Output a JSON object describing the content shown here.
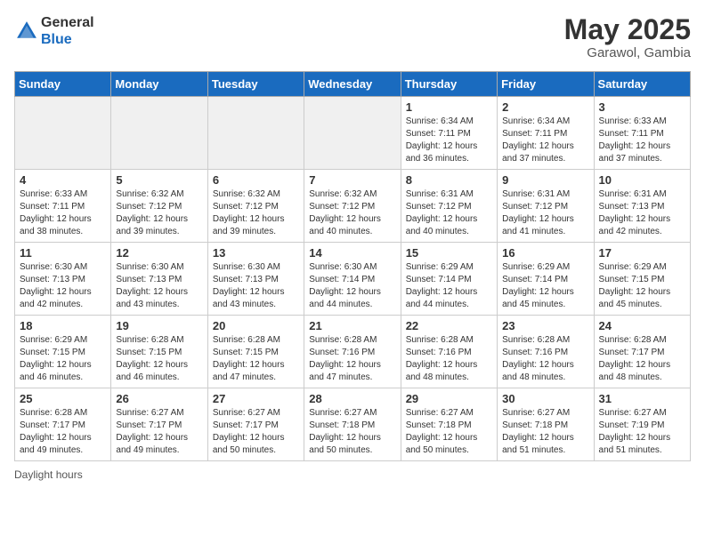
{
  "header": {
    "logo_general": "General",
    "logo_blue": "Blue",
    "month_year": "May 2025",
    "location": "Garawol, Gambia"
  },
  "days_of_week": [
    "Sunday",
    "Monday",
    "Tuesday",
    "Wednesday",
    "Thursday",
    "Friday",
    "Saturday"
  ],
  "weeks": [
    [
      {
        "day": "",
        "info": "",
        "shaded": true
      },
      {
        "day": "",
        "info": "",
        "shaded": true
      },
      {
        "day": "",
        "info": "",
        "shaded": true
      },
      {
        "day": "",
        "info": "",
        "shaded": true
      },
      {
        "day": "1",
        "info": "Sunrise: 6:34 AM\nSunset: 7:11 PM\nDaylight: 12 hours and 36 minutes."
      },
      {
        "day": "2",
        "info": "Sunrise: 6:34 AM\nSunset: 7:11 PM\nDaylight: 12 hours and 37 minutes."
      },
      {
        "day": "3",
        "info": "Sunrise: 6:33 AM\nSunset: 7:11 PM\nDaylight: 12 hours and 37 minutes."
      }
    ],
    [
      {
        "day": "4",
        "info": "Sunrise: 6:33 AM\nSunset: 7:11 PM\nDaylight: 12 hours and 38 minutes."
      },
      {
        "day": "5",
        "info": "Sunrise: 6:32 AM\nSunset: 7:12 PM\nDaylight: 12 hours and 39 minutes."
      },
      {
        "day": "6",
        "info": "Sunrise: 6:32 AM\nSunset: 7:12 PM\nDaylight: 12 hours and 39 minutes."
      },
      {
        "day": "7",
        "info": "Sunrise: 6:32 AM\nSunset: 7:12 PM\nDaylight: 12 hours and 40 minutes."
      },
      {
        "day": "8",
        "info": "Sunrise: 6:31 AM\nSunset: 7:12 PM\nDaylight: 12 hours and 40 minutes."
      },
      {
        "day": "9",
        "info": "Sunrise: 6:31 AM\nSunset: 7:12 PM\nDaylight: 12 hours and 41 minutes."
      },
      {
        "day": "10",
        "info": "Sunrise: 6:31 AM\nSunset: 7:13 PM\nDaylight: 12 hours and 42 minutes."
      }
    ],
    [
      {
        "day": "11",
        "info": "Sunrise: 6:30 AM\nSunset: 7:13 PM\nDaylight: 12 hours and 42 minutes."
      },
      {
        "day": "12",
        "info": "Sunrise: 6:30 AM\nSunset: 7:13 PM\nDaylight: 12 hours and 43 minutes."
      },
      {
        "day": "13",
        "info": "Sunrise: 6:30 AM\nSunset: 7:13 PM\nDaylight: 12 hours and 43 minutes."
      },
      {
        "day": "14",
        "info": "Sunrise: 6:30 AM\nSunset: 7:14 PM\nDaylight: 12 hours and 44 minutes."
      },
      {
        "day": "15",
        "info": "Sunrise: 6:29 AM\nSunset: 7:14 PM\nDaylight: 12 hours and 44 minutes."
      },
      {
        "day": "16",
        "info": "Sunrise: 6:29 AM\nSunset: 7:14 PM\nDaylight: 12 hours and 45 minutes."
      },
      {
        "day": "17",
        "info": "Sunrise: 6:29 AM\nSunset: 7:15 PM\nDaylight: 12 hours and 45 minutes."
      }
    ],
    [
      {
        "day": "18",
        "info": "Sunrise: 6:29 AM\nSunset: 7:15 PM\nDaylight: 12 hours and 46 minutes."
      },
      {
        "day": "19",
        "info": "Sunrise: 6:28 AM\nSunset: 7:15 PM\nDaylight: 12 hours and 46 minutes."
      },
      {
        "day": "20",
        "info": "Sunrise: 6:28 AM\nSunset: 7:15 PM\nDaylight: 12 hours and 47 minutes."
      },
      {
        "day": "21",
        "info": "Sunrise: 6:28 AM\nSunset: 7:16 PM\nDaylight: 12 hours and 47 minutes."
      },
      {
        "day": "22",
        "info": "Sunrise: 6:28 AM\nSunset: 7:16 PM\nDaylight: 12 hours and 48 minutes."
      },
      {
        "day": "23",
        "info": "Sunrise: 6:28 AM\nSunset: 7:16 PM\nDaylight: 12 hours and 48 minutes."
      },
      {
        "day": "24",
        "info": "Sunrise: 6:28 AM\nSunset: 7:17 PM\nDaylight: 12 hours and 48 minutes."
      }
    ],
    [
      {
        "day": "25",
        "info": "Sunrise: 6:28 AM\nSunset: 7:17 PM\nDaylight: 12 hours and 49 minutes."
      },
      {
        "day": "26",
        "info": "Sunrise: 6:27 AM\nSunset: 7:17 PM\nDaylight: 12 hours and 49 minutes."
      },
      {
        "day": "27",
        "info": "Sunrise: 6:27 AM\nSunset: 7:17 PM\nDaylight: 12 hours and 50 minutes."
      },
      {
        "day": "28",
        "info": "Sunrise: 6:27 AM\nSunset: 7:18 PM\nDaylight: 12 hours and 50 minutes."
      },
      {
        "day": "29",
        "info": "Sunrise: 6:27 AM\nSunset: 7:18 PM\nDaylight: 12 hours and 50 minutes."
      },
      {
        "day": "30",
        "info": "Sunrise: 6:27 AM\nSunset: 7:18 PM\nDaylight: 12 hours and 51 minutes."
      },
      {
        "day": "31",
        "info": "Sunrise: 6:27 AM\nSunset: 7:19 PM\nDaylight: 12 hours and 51 minutes."
      }
    ]
  ],
  "footer": {
    "note": "Daylight hours"
  }
}
